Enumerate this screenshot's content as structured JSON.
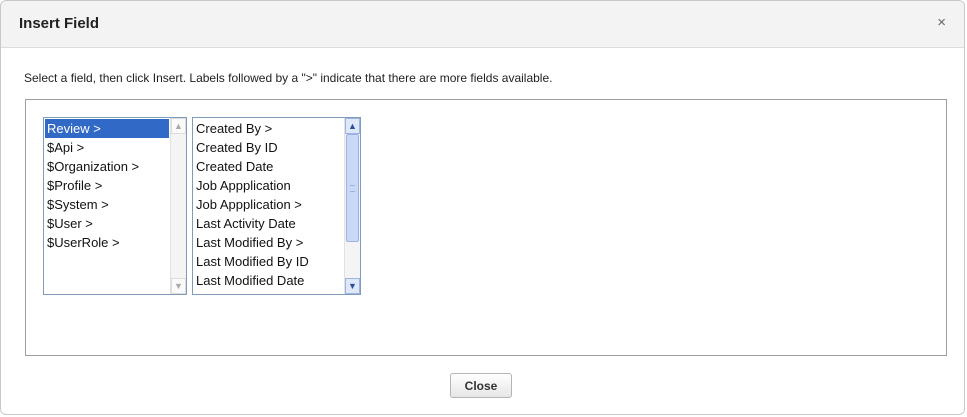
{
  "dialog": {
    "title": "Insert Field",
    "close_glyph": "×",
    "close_icon": "close-icon"
  },
  "instructions": "Select a field, then click Insert. Labels followed by a \">\" indicate that there are more fields available.",
  "object_list": {
    "selected_index": 0,
    "items": [
      {
        "label": "Review >"
      },
      {
        "label": "$Api >"
      },
      {
        "label": "$Organization >"
      },
      {
        "label": "$Profile >"
      },
      {
        "label": "$System >"
      },
      {
        "label": "$User >"
      },
      {
        "label": "$UserRole >"
      }
    ]
  },
  "field_list": {
    "items": [
      {
        "label": "Created By >"
      },
      {
        "label": "Created By ID"
      },
      {
        "label": "Created Date"
      },
      {
        "label": "Job Appplication"
      },
      {
        "label": "Job Appplication >"
      },
      {
        "label": "Last Activity Date"
      },
      {
        "label": "Last Modified By >"
      },
      {
        "label": "Last Modified By ID"
      },
      {
        "label": "Last Modified Date"
      }
    ],
    "scroll_fraction": 0.0
  },
  "footer": {
    "close_label": "Close"
  },
  "colors": {
    "selection": "#3169c6",
    "listbox_border": "#7f9db9"
  }
}
